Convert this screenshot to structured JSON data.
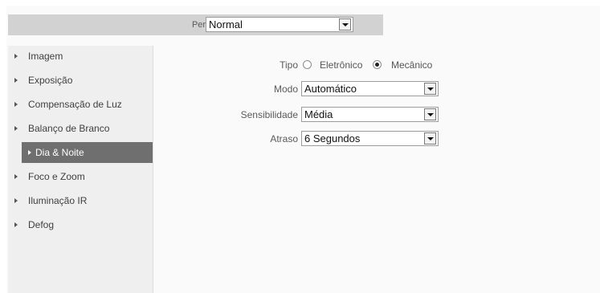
{
  "profile": {
    "label": "Perfil",
    "value": "Normal"
  },
  "sidebar": {
    "items": [
      {
        "label": "Imagem",
        "active": false
      },
      {
        "label": "Exposição",
        "active": false
      },
      {
        "label": "Compensação de Luz",
        "active": false
      },
      {
        "label": "Balanço de Branco",
        "active": false
      },
      {
        "label": "Dia & Noite",
        "active": true
      },
      {
        "label": "Foco e Zoom",
        "active": false
      },
      {
        "label": "Iluminação IR",
        "active": false
      },
      {
        "label": "Defog",
        "active": false
      }
    ]
  },
  "form": {
    "tipo": {
      "label": "Tipo",
      "options": [
        "Eletrônico",
        "Mecânico"
      ],
      "selected": "Mecânico"
    },
    "modo": {
      "label": "Modo",
      "value": "Automático"
    },
    "sensibilidade": {
      "label": "Sensibilidade",
      "value": "Média"
    },
    "atraso": {
      "label": "Atraso",
      "value": "6 Segundos"
    }
  },
  "colors": {
    "active_item_bg": "#6f6f6f",
    "profile_bar_bg": "#d2d2d2"
  }
}
